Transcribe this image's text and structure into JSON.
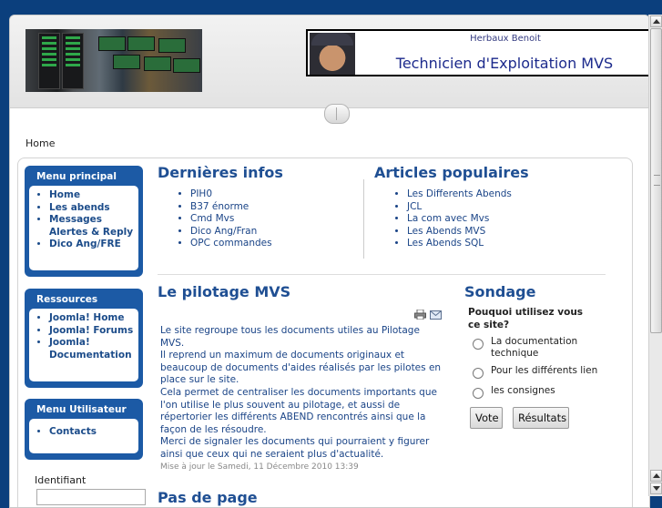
{
  "header": {
    "banner_name": "Herbaux Benoit",
    "banner_title": "Technicien d'Exploitation MVS"
  },
  "breadcrumb": "Home",
  "menu_principal": {
    "title": "Menu principal",
    "items": [
      "Home",
      "Les abends",
      "Messages Alertes & Reply",
      "Dico Ang/FRE"
    ]
  },
  "ressources": {
    "title": "Ressources",
    "items": [
      "Joomla! Home",
      "Joomla! Forums",
      "Joomla! Documentation"
    ]
  },
  "menu_utilisateur": {
    "title": "Menu Utilisateur",
    "items": [
      "Contacts"
    ]
  },
  "login": {
    "label": "Identifiant"
  },
  "dernieres_infos": {
    "title": "Dernières infos",
    "items": [
      "PIH0",
      "B37 énorme",
      "Cmd Mvs",
      "Dico Ang/Fran",
      "OPC commandes"
    ]
  },
  "articles_populaires": {
    "title": "Articles populaires",
    "items": [
      "Les Differents Abends",
      "JCL",
      "La com avec Mvs",
      "Les Abends MVS",
      "Les Abends SQL"
    ]
  },
  "article": {
    "title": "Le pilotage MVS",
    "paragraphs": [
      "Le site regroupe tous les documents utiles au Pilotage MVS.",
      "Il reprend un maximum de documents originaux et beaucoup de documents d'aides réalisés par les pilotes en place sur le site.",
      "Cela permet de centraliser  les documents importants que l'on utilise le plus souvent au pilotage, et aussi de répertorier les différents ABEND rencontrés ainsi que la façon de les résoudre.",
      "Merci de signaler les documents qui pourraient y figurer ainsi que ceux qui ne seraient plus d'actualité."
    ],
    "date": "Mise à jour le Samedi, 11 Décembre 2010 13:39",
    "next_title": "Pas de page"
  },
  "poll": {
    "title": "Sondage",
    "question": "Pouquoi utilisez vous ce site?",
    "options": [
      "La documentation technique",
      "Pour les différents lien",
      "les consignes"
    ],
    "vote_label": "Vote",
    "results_label": "Résultats"
  },
  "icons": {
    "print": "print-icon",
    "email": "email-icon"
  }
}
